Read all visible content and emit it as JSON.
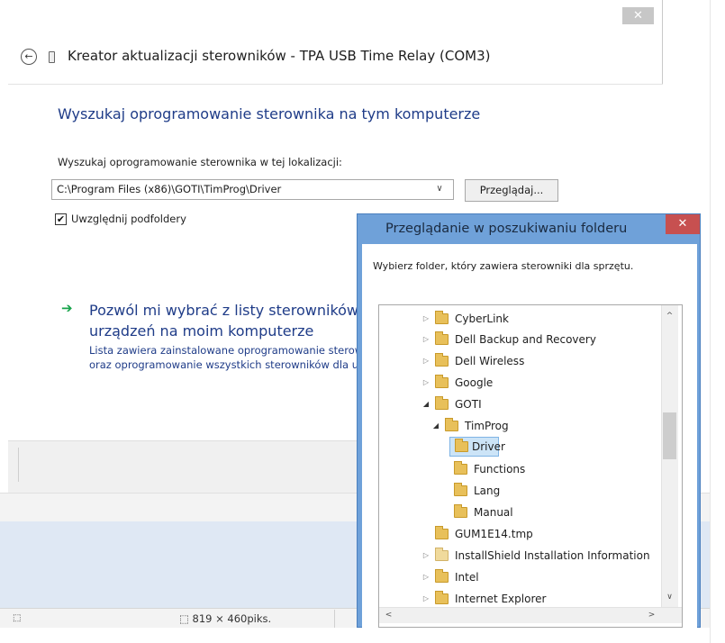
{
  "wizard": {
    "close_glyph": "✕",
    "back_glyph": "←",
    "title": "Kreator aktualizacji sterowników - TPA USB Time Relay (COM3)",
    "heading": "Wyszukaj oprogramowanie sterownika na tym komputerze",
    "location_label": "Wyszukaj oprogramowanie sterownika w tej lokalizacji:",
    "path_value": "C:\\Program Files (x86)\\GOTI\\TimProg\\Driver",
    "dropdown_glyph": "∨",
    "browse_label": "Przeglądaj...",
    "include_subfolders_label": "Uwzględnij podfoldery",
    "include_subfolders_checked": "✔",
    "choose_arrow": "➔",
    "choose_title": "Pozwól mi wybrać z listy sterowników urządzeń na moim komputerze",
    "choose_desc_line1": "Lista zawiera zainstalowane oprogramowanie sterowników zgodne z urządzeniem",
    "choose_desc_line2": "oraz oprogramowanie wszystkich sterowników dla urządzeń z tej samej kategorii."
  },
  "status_bar": {
    "left_icon": "⬚",
    "size_text": "⬚ 819 × 460piks."
  },
  "dialog": {
    "title": "Przeglądanie w poszukiwaniu folderu",
    "close_glyph": "✕",
    "description": "Wybierz folder, który zawiera sterowniki dla sprzętu.",
    "tree": [
      {
        "label": "CyberLink",
        "arrow": "▷"
      },
      {
        "label": "Dell Backup and Recovery",
        "arrow": "▷"
      },
      {
        "label": "Dell Wireless",
        "arrow": "▷"
      },
      {
        "label": "Google",
        "arrow": "▷"
      },
      {
        "label": "GOTI",
        "arrow": "◢"
      },
      {
        "label": "TimProg",
        "arrow": "◢"
      },
      {
        "label": "Driver",
        "arrow": ""
      },
      {
        "label": "Functions",
        "arrow": ""
      },
      {
        "label": "Lang",
        "arrow": ""
      },
      {
        "label": "Manual",
        "arrow": ""
      },
      {
        "label": "GUM1E14.tmp",
        "arrow": ""
      },
      {
        "label": "InstallShield Installation Information",
        "arrow": "▷"
      },
      {
        "label": "Intel",
        "arrow": "▷"
      },
      {
        "label": "Internet Explorer",
        "arrow": "▷"
      }
    ],
    "scroll_up_glyph": "^",
    "scroll_down_glyph": "∨",
    "scroll_left_glyph": "<",
    "scroll_right_glyph": ">"
  }
}
